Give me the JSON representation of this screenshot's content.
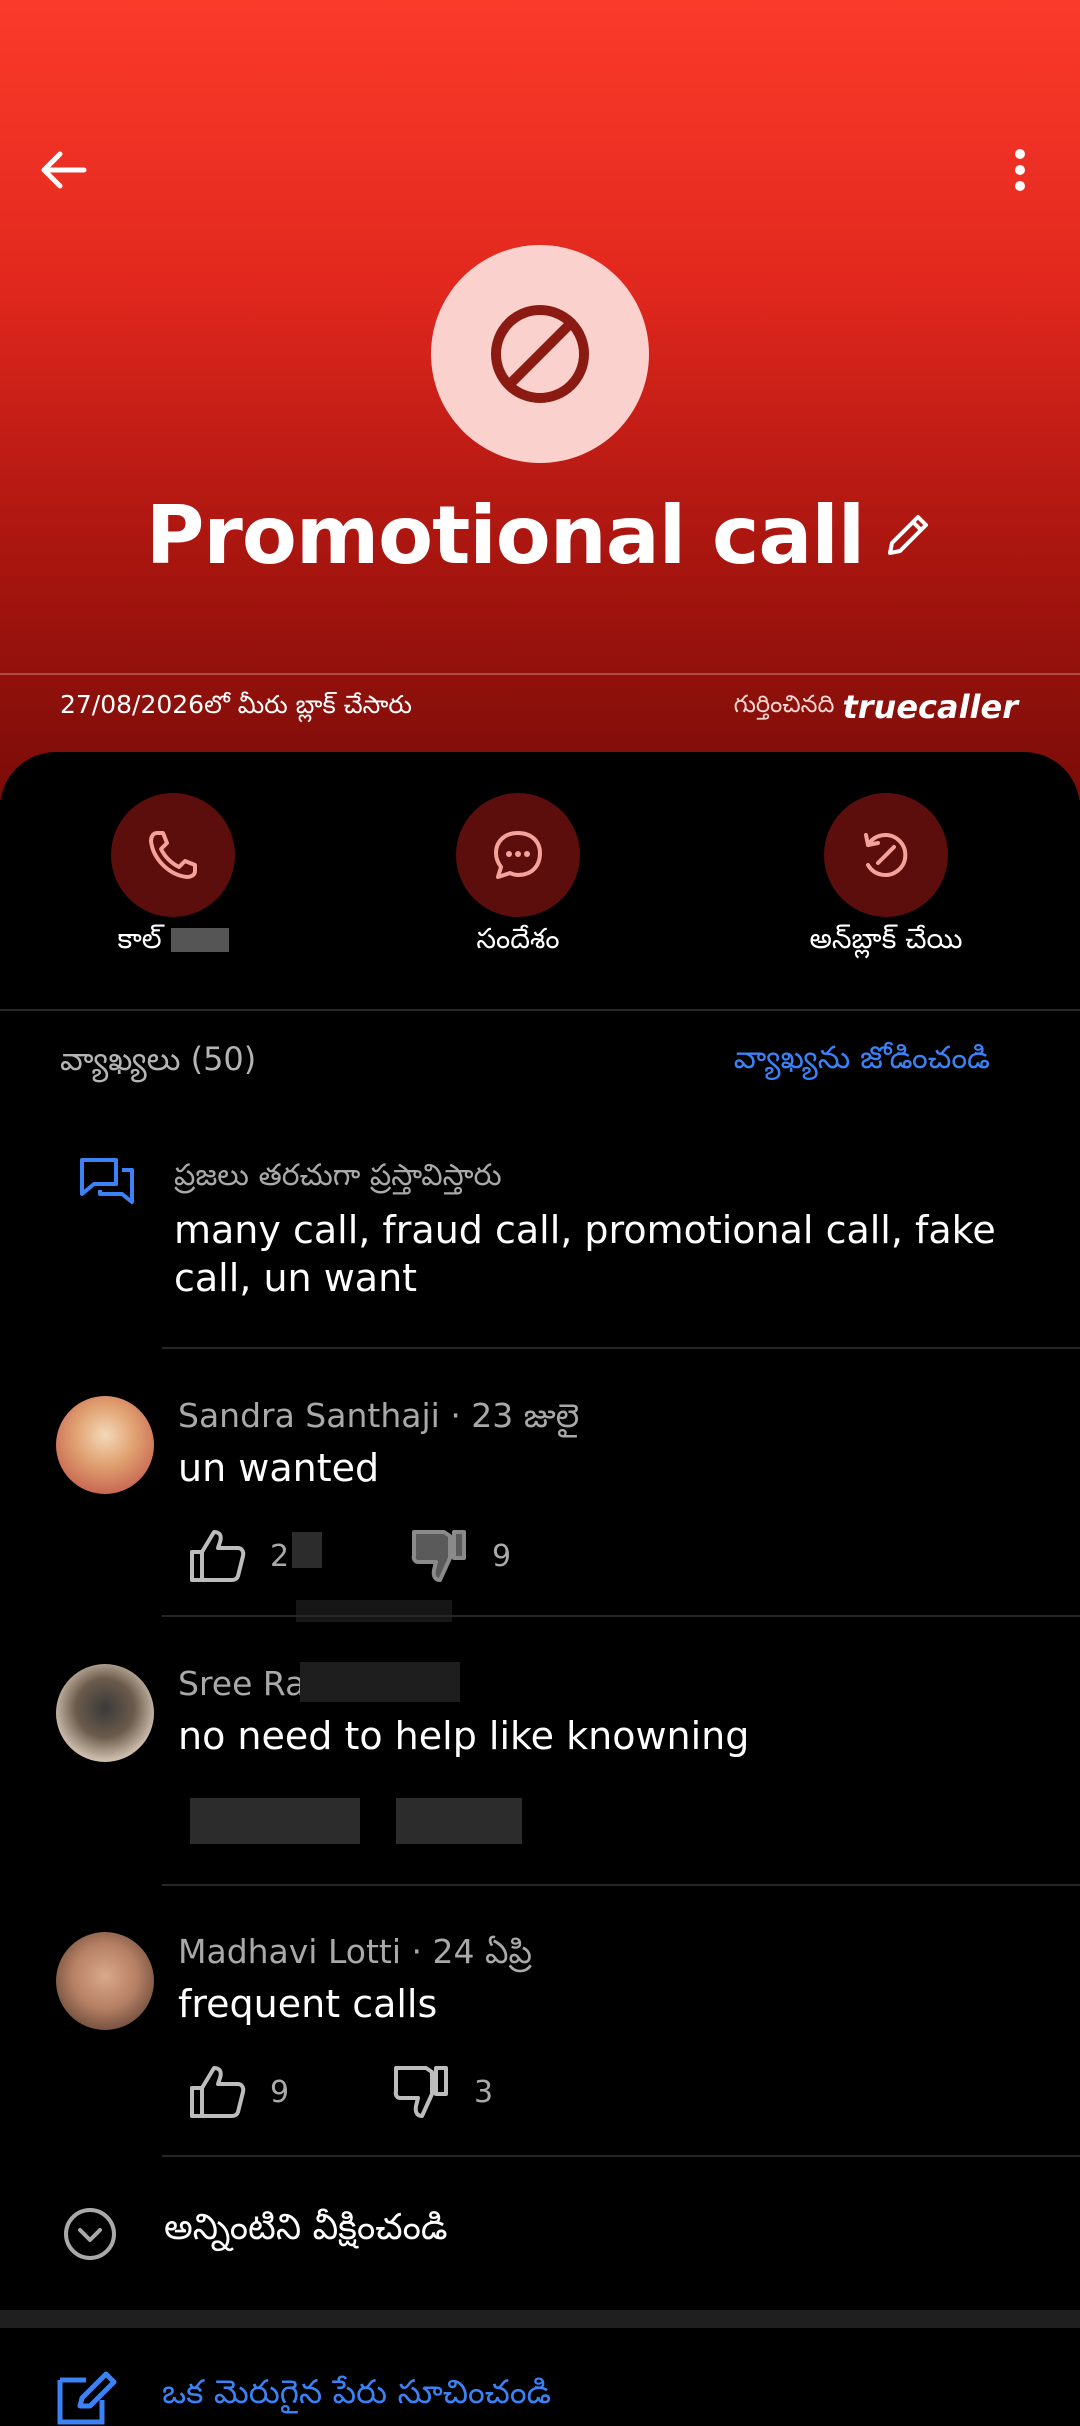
{
  "header": {
    "title": "Promotional call",
    "blocked_info": "27/08/2026లో మీరు బ్లాక్ చేసారు",
    "identified_by": "గుర్తించినది",
    "brand": "truecaller"
  },
  "actions": [
    {
      "label": "కాల్ "
    },
    {
      "label": "సందేశం"
    },
    {
      "label": "అన్‌బ్లాక్ చేయి"
    }
  ],
  "comments_section": {
    "title": "వ్యాఖ్యలు (50)",
    "add_comment": "వ్యాఖ్యను జోడించండి",
    "mentions_caption": "ప్రజలు తరచుగా ప్రస్తావిస్తారు",
    "mentions": "many call, fraud call, promotional call, fake call, un want"
  },
  "comments": [
    {
      "name": "Sandra Santhaji",
      "date": "· 23 జులై",
      "text": "un wanted",
      "likes": "2",
      "dislikes": "9"
    },
    {
      "name": "Sree Ra",
      "date": "",
      "text": "no need to help like knowning",
      "likes": "",
      "dislikes": ""
    },
    {
      "name": "Madhavi Lotti",
      "date": "· 24 ఏప్రి",
      "text": "frequent calls",
      "likes": "9",
      "dislikes": "3"
    }
  ],
  "view_all": "అన్నింటిని వీక్షించండి",
  "suggest_name": "ఒక మెరుగైన పేరు సూచించండి",
  "colors": {
    "accent_blue": "#3b82f6",
    "header_red": "#e2281e",
    "avatar_bg": "#fbd1cd"
  }
}
